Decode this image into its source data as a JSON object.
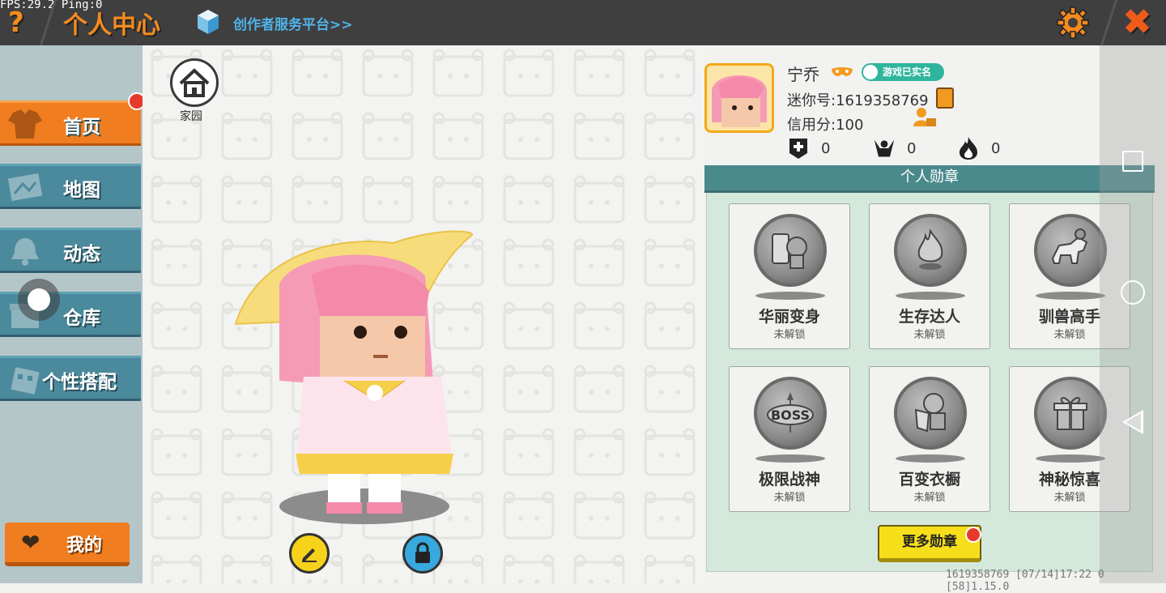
{
  "debug": {
    "fps": "FPS:29.2",
    "ping": "Ping:0"
  },
  "header": {
    "help_icon": "?",
    "title": "个人中心",
    "creator_link": "创作者服务平台>>",
    "settings_icon": "gear-icon",
    "close_icon": "✖"
  },
  "sidebar": {
    "items": [
      {
        "label": "首页",
        "icon": "shirt-icon",
        "active": true
      },
      {
        "label": "地图",
        "icon": "map-icon",
        "active": false
      },
      {
        "label": "动态",
        "icon": "bell-icon",
        "active": false
      },
      {
        "label": "仓库",
        "icon": "box-icon",
        "active": false
      },
      {
        "label": "个性搭配",
        "icon": "outfit-icon",
        "active": false
      }
    ],
    "mine_button": {
      "label": "我的",
      "icon": "heart-icon"
    }
  },
  "scene": {
    "home_label": "家园"
  },
  "profile": {
    "name": "宁乔",
    "verified_badge": "游戏已实名",
    "mini_id": "迷你号:1619358769",
    "credit": "信用分:100",
    "stats": [
      {
        "icon": "add-friend-icon",
        "value": "0"
      },
      {
        "icon": "fans-icon",
        "value": "0"
      },
      {
        "icon": "flame-icon",
        "value": "0"
      }
    ]
  },
  "medals": {
    "header": "个人勋章",
    "items": [
      {
        "name": "华丽变身",
        "status": "未解锁",
        "icon": "transform-medal-icon"
      },
      {
        "name": "生存达人",
        "status": "未解锁",
        "icon": "campfire-medal-icon"
      },
      {
        "name": "驯兽高手",
        "status": "未解锁",
        "icon": "horse-medal-icon"
      },
      {
        "name": "极限战神",
        "status": "未解锁",
        "icon": "boss-medal-icon"
      },
      {
        "name": "百变衣橱",
        "status": "未解锁",
        "icon": "wardrobe-medal-icon"
      },
      {
        "name": "神秘惊喜",
        "status": "未解锁",
        "icon": "gift-medal-icon"
      }
    ],
    "more_button": "更多勋章"
  },
  "footer": "1619358769   [07/14]17:22 0  [58]1.15.0"
}
